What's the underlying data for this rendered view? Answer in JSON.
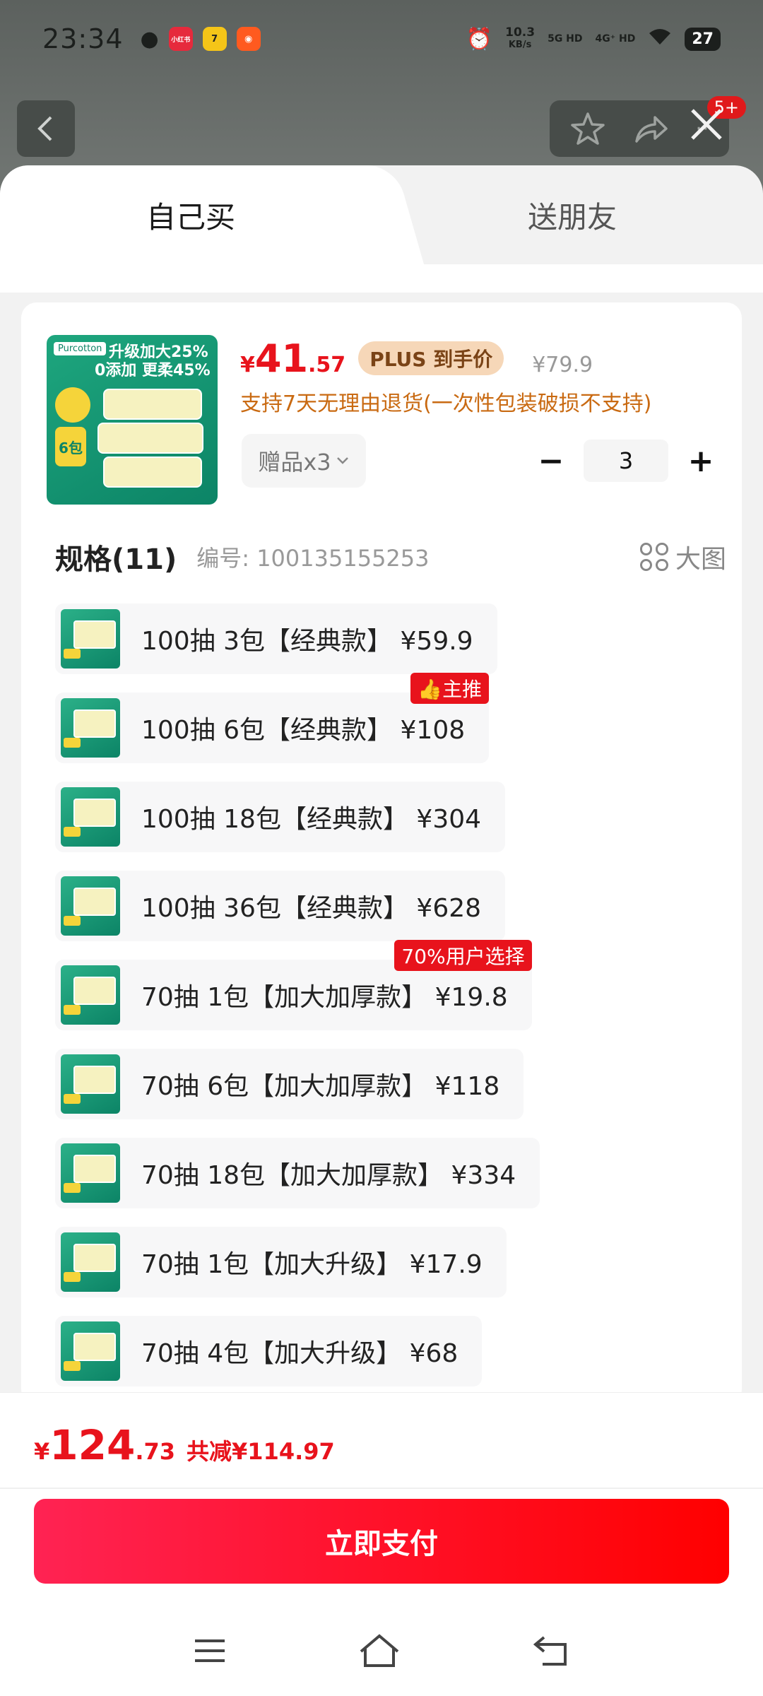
{
  "status_bar": {
    "time": "23:34",
    "net_speed": "10.3",
    "net_unit": "KB/s",
    "sig1": "5G HD",
    "sig2": "4G⁺ HD",
    "battery": "27",
    "app_labels": [
      "小红书"
    ]
  },
  "top_nav": {
    "badge": "5+"
  },
  "tabs": {
    "self_buy": "自己买",
    "gift_friend": "送朋友"
  },
  "product": {
    "thumb_brand": "Purcotton",
    "thumb_line1": "升级加大25%",
    "thumb_line2": "0添加 更柔45%",
    "thumb_count": "6包",
    "currency": "¥",
    "price_int": "41",
    "price_dec": ".57",
    "plus_label": "PLUS 到手价",
    "original_price": "¥79.9",
    "return_policy": "支持7天无理由退货(一次性包装破损不支持)",
    "gift_label": "赠品x3",
    "quantity": "3",
    "minus": "−",
    "plus": "+"
  },
  "spec": {
    "title": "规格(11)",
    "code": "编号: 100135155253",
    "big_pic": "大图"
  },
  "options": [
    {
      "label": "100抽 3包【经典款】 ¥59.9",
      "tag": ""
    },
    {
      "label": "100抽 6包【经典款】 ¥108",
      "tag": "主推"
    },
    {
      "label": "100抽 18包【经典款】 ¥304",
      "tag": ""
    },
    {
      "label": "100抽 36包【经典款】 ¥628",
      "tag": ""
    },
    {
      "label": "70抽 1包【加大加厚款】 ¥19.8",
      "tag": "70%用户选择"
    },
    {
      "label": "70抽 6包【加大加厚款】 ¥118",
      "tag": ""
    },
    {
      "label": "70抽 18包【加大加厚款】 ¥334",
      "tag": ""
    },
    {
      "label": "70抽 1包【加大升级】 ¥17.9",
      "tag": ""
    },
    {
      "label": "70抽 4包【加大升级】 ¥68",
      "tag": ""
    }
  ],
  "footer": {
    "currency": "¥",
    "total_int": "124",
    "total_dec": ".73",
    "savings": "共减¥114.97",
    "pay_button": "立即支付"
  },
  "colors": {
    "accent_red": "#e8131c",
    "return_orange": "#c96a12",
    "plus_badge_bg": "#f6d7b8"
  }
}
